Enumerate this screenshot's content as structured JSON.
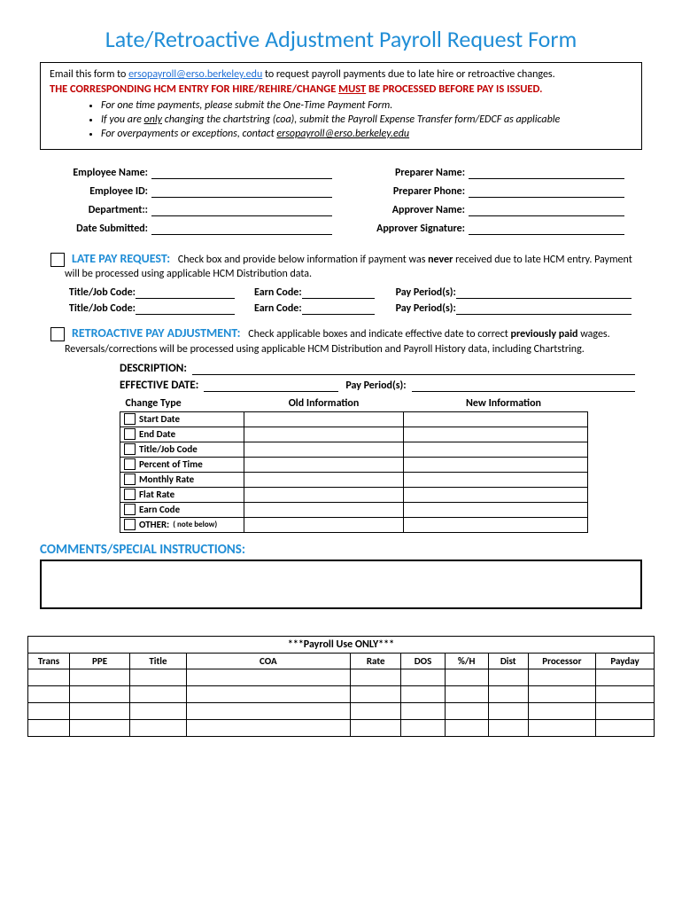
{
  "title": "Late/Retroactive Adjustment Payroll Request Form",
  "intro": {
    "line1_pre": "Email this form to ",
    "email": "ersopayroll@erso.berkeley.edu",
    "line1_post": " to request payroll payments due to late hire or retroactive changes.",
    "red_pre": "THE CORRESPONDING HCM ENTRY FOR HIRE/REHIRE/CHANGE ",
    "red_u": "MUST",
    "red_post": " BE PROCESSED BEFORE PAY IS ISSUED.",
    "bullets": {
      "b1": "For one time payments, please submit the One-Time Payment Form.",
      "b2_pre": "If you are ",
      "b2_u": "only",
      "b2_post": " changing the chartstring (coa), submit the Payroll Expense Transfer form/EDCF as applicable",
      "b3_pre": "For overpayments or exceptions, contact ",
      "b3_link": "ersopayroll@erso.berkeley.edu"
    }
  },
  "meta": {
    "emp_name": "Employee Name:",
    "prep_name": "Preparer Name:",
    "emp_id": "Employee ID:",
    "prep_phone": "Preparer Phone:",
    "dept": "Department::",
    "appr_name": "Approver Name:",
    "date_sub": "Date Submitted:",
    "appr_sig": "Approver Signature:"
  },
  "late": {
    "header": "LATE PAY REQUEST:",
    "text": "Check box and provide below information if payment was ",
    "text_bold": "never",
    "text_post": " received due to late HCM entry. Payment will be processed using applicable HCM Distribution data.",
    "title_label": "Title/Job Code:",
    "earn_label": "Earn Code:",
    "pay_label": "Pay Period(s):"
  },
  "retro": {
    "header": "RETROACTIVE PAY ADJUSTMENT:",
    "text_pre": "Check applicable boxes and indicate effective date to correct ",
    "text_bold": "previously paid",
    "text_post": " wages.  Reversals/corrections will be processed using applicable HCM Distribution and Payroll History data, including Chartstring.",
    "desc": "DESCRIPTION:",
    "eff": "EFFECTIVE DATE:",
    "pay": "Pay Period(s):",
    "col_change": "Change Type",
    "col_old": "Old Information",
    "col_new": "New Information",
    "rows": {
      "r0": "Start Date",
      "r1": "End Date",
      "r2": "Title/Job Code",
      "r3": "Percent of Time",
      "r4": "Monthly Rate",
      "r5": "Flat Rate",
      "r6": "Earn Code",
      "r7": "OTHER:",
      "r7_note": "( note below)"
    }
  },
  "comments_hd": "COMMENTS/SPECIAL INSTRUCTIONS:",
  "payroll": {
    "header": "***Payroll Use ONLY***",
    "cols": {
      "c0": "Trans",
      "c1": "PPE",
      "c2": "Title",
      "c3": "COA",
      "c4": "Rate",
      "c5": "DOS",
      "c6": "%/H",
      "c7": "Dist",
      "c8": "Processor",
      "c9": "Payday"
    }
  }
}
